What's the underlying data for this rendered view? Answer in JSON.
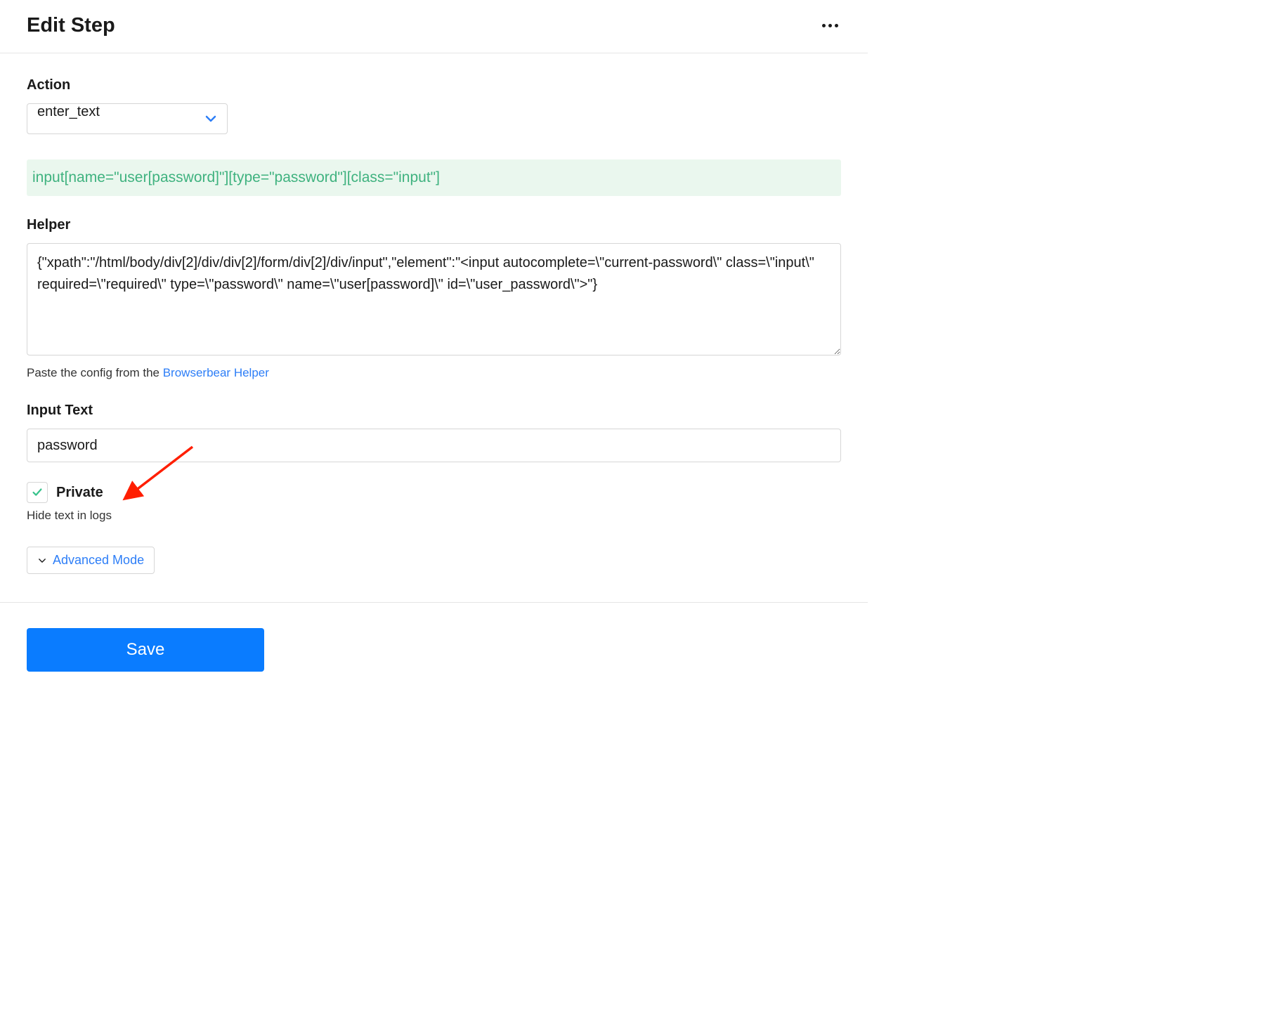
{
  "header": {
    "title": "Edit Step"
  },
  "action": {
    "label": "Action",
    "selected": "enter_text"
  },
  "selector_preview": "input[name=\"user[password]\"][type=\"password\"][class=\"input\"]",
  "helper": {
    "label": "Helper",
    "value": "{\"xpath\":\"/html/body/div[2]/div/div[2]/form/div[2]/div/input\",\"element\":\"<input autocomplete=\\\"current-password\\\" class=\\\"input\\\" required=\\\"required\\\" type=\\\"password\\\" name=\\\"user[password]\\\" id=\\\"user_password\\\">\"}",
    "hint_prefix": "Paste the config from the ",
    "hint_link": "Browserbear Helper"
  },
  "input_text": {
    "label": "Input Text",
    "value": "password"
  },
  "private": {
    "label": "Private",
    "checked": true,
    "hint": "Hide text in logs"
  },
  "advanced": {
    "label": "Advanced Mode"
  },
  "footer": {
    "save_label": "Save"
  }
}
